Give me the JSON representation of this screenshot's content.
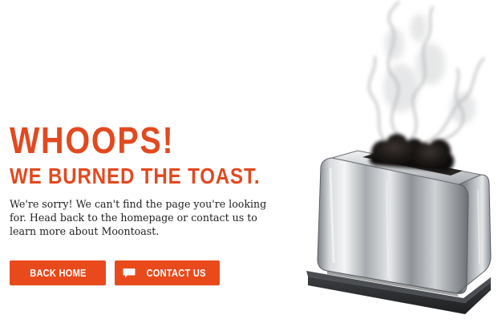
{
  "hero": {
    "headline": "WHOOPS!",
    "subheadline": "WE BURNED THE TOAST.",
    "message": "We're sorry! We can't find the page you're looking for. Head back to the homepage or contact us to learn more about Moontoast."
  },
  "actions": {
    "back_home_label": "BACK HOME",
    "contact_us_label": "CONTACT US"
  },
  "illustration": {
    "icon": "burnt-toaster-illustration"
  },
  "colors": {
    "accent": "#e2491f",
    "button": "#e84a1c",
    "text": "#222222",
    "background": "#ffffff"
  }
}
